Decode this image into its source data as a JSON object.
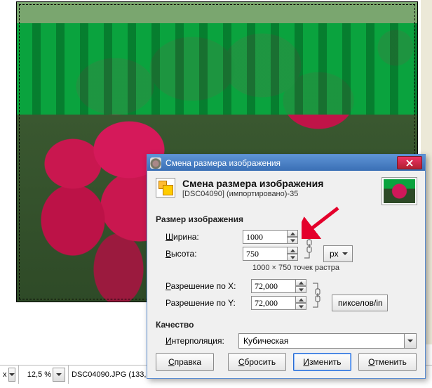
{
  "statusbar": {
    "unit_label": "x",
    "zoom": "12,5 %",
    "filename": "DSC04090.JPG (133,"
  },
  "dialog": {
    "title": "Смена размера изображения",
    "header_title": "Смена размера изображения",
    "header_sub": "[DSC04090] (импортировано)-35",
    "size_section": "Размер изображения",
    "width_label_pre": "Ш",
    "width_label_post": "ирина:",
    "height_label_pre": "В",
    "height_label_post": "ысота:",
    "width_value": "1000",
    "height_value": "750",
    "unit_size": "px",
    "raster_note": "1000 × 750 точек растра",
    "resx_pre": "Р",
    "resx_post": "азрешение по X:",
    "resy_post": "Разрешение по Y:",
    "res_x": "72,000",
    "res_y": "72,000",
    "unit_res": "пикселов/in",
    "quality_section": "Качество",
    "interp_pre": "И",
    "interp_post": "нтерполяция:",
    "interp_value": "Кубическая",
    "btn_help_pre": "С",
    "btn_help_post": "правка",
    "btn_reset_pre": "С",
    "btn_reset_post": "бросить",
    "btn_apply_pre": "И",
    "btn_apply_post": "зменить",
    "btn_cancel_pre": "О",
    "btn_cancel_post": "тменить"
  }
}
